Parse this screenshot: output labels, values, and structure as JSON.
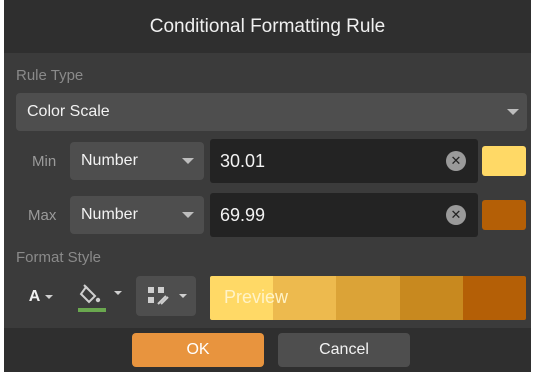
{
  "dialog": {
    "title": "Conditional Formatting Rule"
  },
  "rule_type": {
    "label": "Rule Type",
    "value": "Color Scale"
  },
  "min_row": {
    "label": "Min",
    "type": "Number",
    "value": "30.01",
    "color": "#FFD966"
  },
  "max_row": {
    "label": "Max",
    "type": "Number",
    "value": "69.99",
    "color": "#B45F06"
  },
  "format_style": {
    "label": "Format Style",
    "font_color_glyph": "A",
    "fill_underline_color": "#6AA84F",
    "preview_label": "Preview",
    "preview_colors": [
      "#FFD966",
      "#EDBA4E",
      "#DBA337",
      "#C8891F",
      "#B45F06"
    ]
  },
  "buttons": {
    "ok": "OK",
    "cancel": "Cancel"
  },
  "colors": {
    "accent": "#E8943E",
    "dialog_bg": "#3B3B3B",
    "title_bg": "#2F2F2F"
  }
}
